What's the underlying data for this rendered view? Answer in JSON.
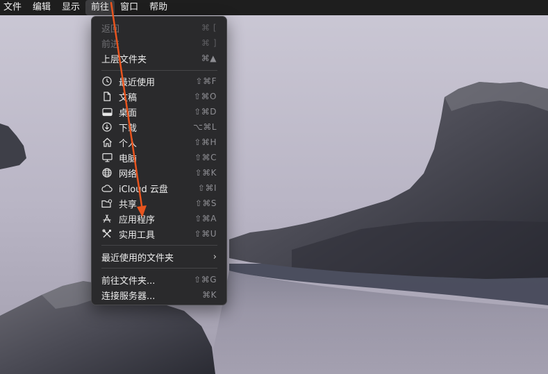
{
  "menubar": {
    "items": [
      "文件",
      "编辑",
      "显示",
      "前往",
      "窗口",
      "帮助"
    ],
    "active_index": 3
  },
  "menu": {
    "top_items": [
      {
        "label": "返回",
        "shortcut": "⌘ [",
        "enabled": false
      },
      {
        "label": "前进",
        "shortcut": "⌘ ]",
        "enabled": false
      },
      {
        "label": "上层文件夹",
        "shortcut": "⌘▲",
        "enabled": true
      }
    ],
    "places": [
      {
        "label": "最近使用",
        "shortcut": "⇧⌘F",
        "icon": "clock-icon"
      },
      {
        "label": "文稿",
        "shortcut": "⇧⌘O",
        "icon": "document-icon"
      },
      {
        "label": "桌面",
        "shortcut": "⇧⌘D",
        "icon": "desktop-icon"
      },
      {
        "label": "下载",
        "shortcut": "⌥⌘L",
        "icon": "download-icon"
      },
      {
        "label": "个人",
        "shortcut": "⇧⌘H",
        "icon": "home-icon"
      },
      {
        "label": "电脑",
        "shortcut": "⇧⌘C",
        "icon": "computer-icon"
      },
      {
        "label": "网络",
        "shortcut": "⇧⌘K",
        "icon": "globe-icon"
      },
      {
        "label": "iCloud 云盘",
        "shortcut": "⇧⌘I",
        "icon": "cloud-icon"
      },
      {
        "label": "共享",
        "shortcut": "⇧⌘S",
        "icon": "shared-folder-icon"
      },
      {
        "label": "应用程序",
        "shortcut": "⇧⌘A",
        "icon": "applications-icon"
      },
      {
        "label": "实用工具",
        "shortcut": "⇧⌘U",
        "icon": "utilities-icon"
      }
    ],
    "recent_folders": {
      "label": "最近使用的文件夹",
      "chevron": "›"
    },
    "bottom_items": [
      {
        "label": "前往文件夹...",
        "shortcut": "⇧⌘G"
      },
      {
        "label": "连接服务器...",
        "shortcut": "⌘K"
      }
    ]
  },
  "colors": {
    "menubar_bg": "#1e1e1e",
    "menu_bg": "#2a2a2c",
    "annotation_arrow": "#e8541e"
  }
}
